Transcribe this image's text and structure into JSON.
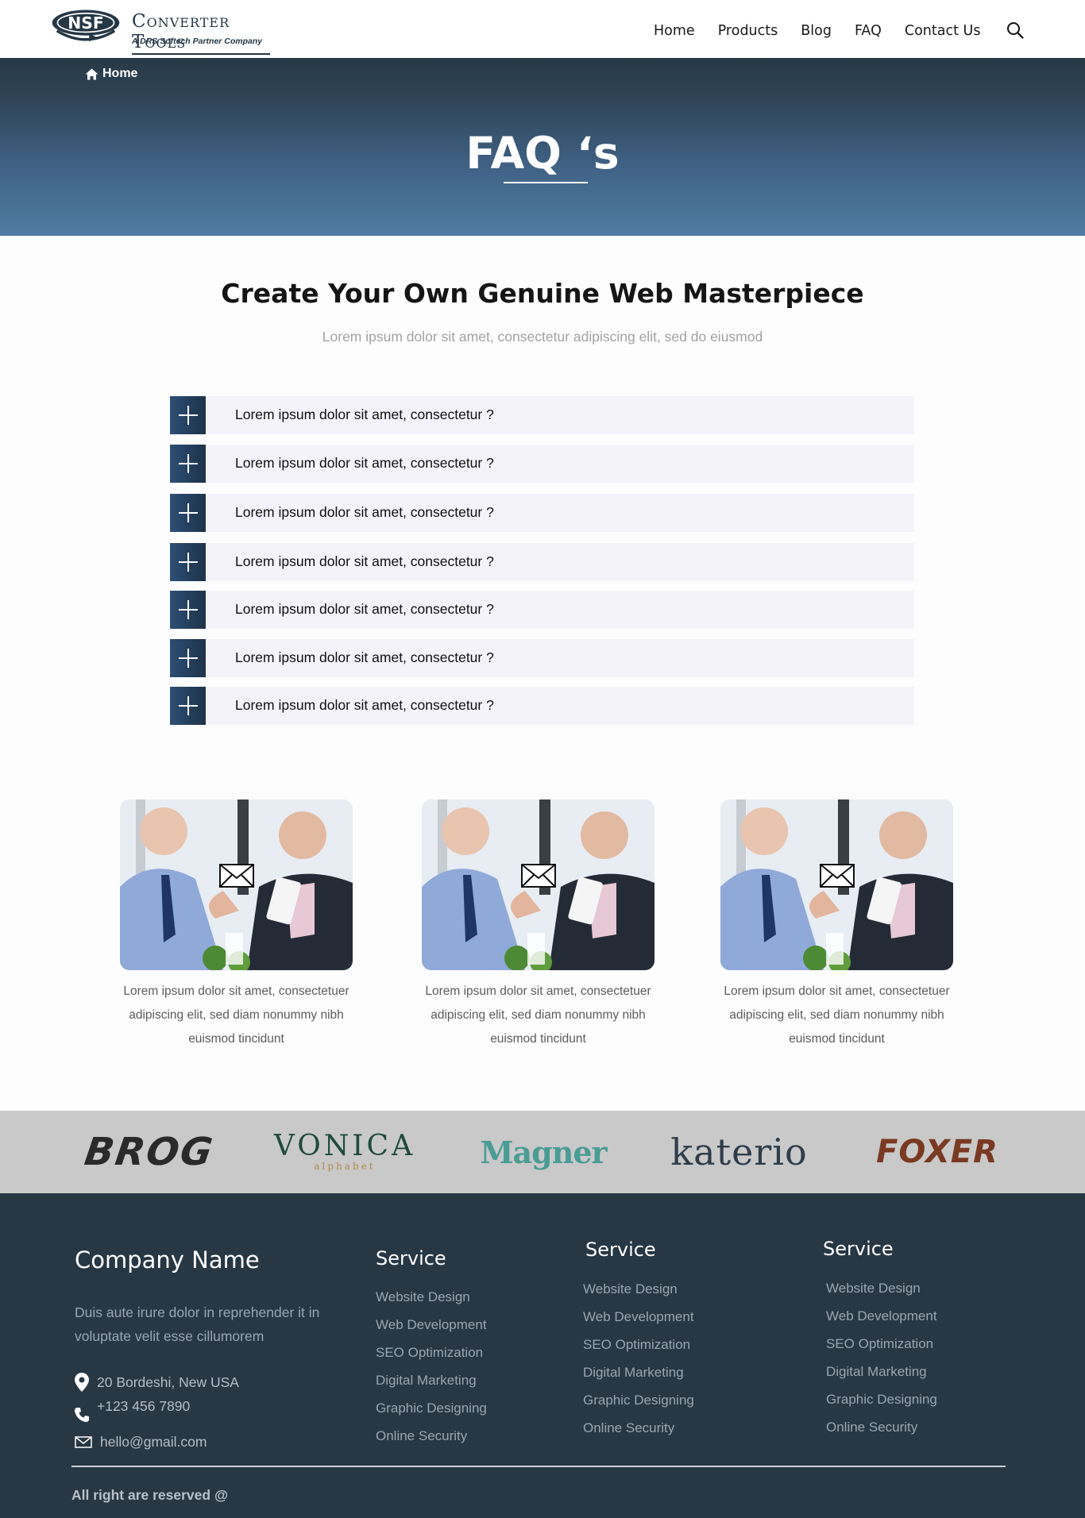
{
  "header": {
    "logo": {
      "mark": "NSF",
      "name": "Converter Tools",
      "tagline": "A DRS Softech Partner Company"
    },
    "nav": [
      "Home",
      "Products",
      "Blog",
      "FAQ",
      "Contact Us"
    ],
    "search_icon": "search-icon"
  },
  "hero": {
    "breadcrumb": "Home",
    "title": "FAQ ‘s"
  },
  "intro": {
    "title": "Create Your Own Genuine Web Masterpiece",
    "subtitle": "Lorem ipsum dolor sit amet, consectetur adipiscing elit, sed do eiusmod"
  },
  "faq": {
    "items": [
      "Lorem ipsum dolor sit amet, consectetur ?",
      "Lorem ipsum dolor sit amet, consectetur ?",
      "Lorem ipsum dolor sit amet, consectetur ?",
      "Lorem ipsum dolor sit amet, consectetur ?",
      "Lorem ipsum dolor sit amet, consectetur ?",
      "Lorem ipsum dolor sit amet, consectetur ?",
      "Lorem ipsum dolor sit amet, consectetur ?"
    ]
  },
  "cards": [
    {
      "text": "Lorem ipsum dolor sit amet, consectetuer adipiscing elit, sed diam nonummy nibh euismod tincidunt",
      "icon": "envelope-icon"
    },
    {
      "text": "Lorem ipsum dolor sit amet, consectetuer adipiscing elit, sed diam nonummy nibh euismod tincidunt",
      "icon": "envelope-icon"
    },
    {
      "text": "Lorem ipsum dolor sit amet, consectetuer adipiscing elit, sed diam nonummy nibh euismod tincidunt",
      "icon": "envelope-icon"
    }
  ],
  "brands": [
    {
      "name": "BROG",
      "color": "#2a2a2a",
      "accent": "#e0262b"
    },
    {
      "name": "VONICA",
      "sub": "alphabet",
      "color": "#1f4a3e",
      "accent": "#b08a45"
    },
    {
      "name": "Magner",
      "color": "#4a9c95"
    },
    {
      "name": "katerio",
      "color": "#2f3d4a"
    },
    {
      "name": "FOXER",
      "color": "#7a3a22",
      "accent": "#e0262b"
    }
  ],
  "footer": {
    "company": "Company Name",
    "description": "Duis aute irure dolor in reprehender it in voluptate velit esse cillumorem",
    "address": "20 Bordeshi, New USA",
    "phone": "+123 456 7890",
    "email": "hello@gmail.com",
    "columns": [
      {
        "title": "Service",
        "links": [
          "Website Design",
          "Web Development",
          "SEO Optimization",
          "Digital Marketing",
          "Graphic Designing",
          "Online Security"
        ]
      },
      {
        "title": "Service",
        "links": [
          "Website Design",
          "Web Development",
          "SEO Optimization",
          "Digital Marketing",
          "Graphic Designing",
          "Online Security"
        ]
      },
      {
        "title": "Service",
        "links": [
          "Website Design",
          "Web Development",
          "SEO Optimization",
          "Digital Marketing",
          "Graphic Designing",
          "Online Security"
        ]
      }
    ],
    "copyright": "All right are reserved @"
  },
  "colors": {
    "primary_dark": "#273743",
    "hero_top": "#283946",
    "hero_bottom": "#4f7ca2",
    "faq_bg": "#f5f3fa",
    "brand_bar": "#c9c9c9"
  }
}
